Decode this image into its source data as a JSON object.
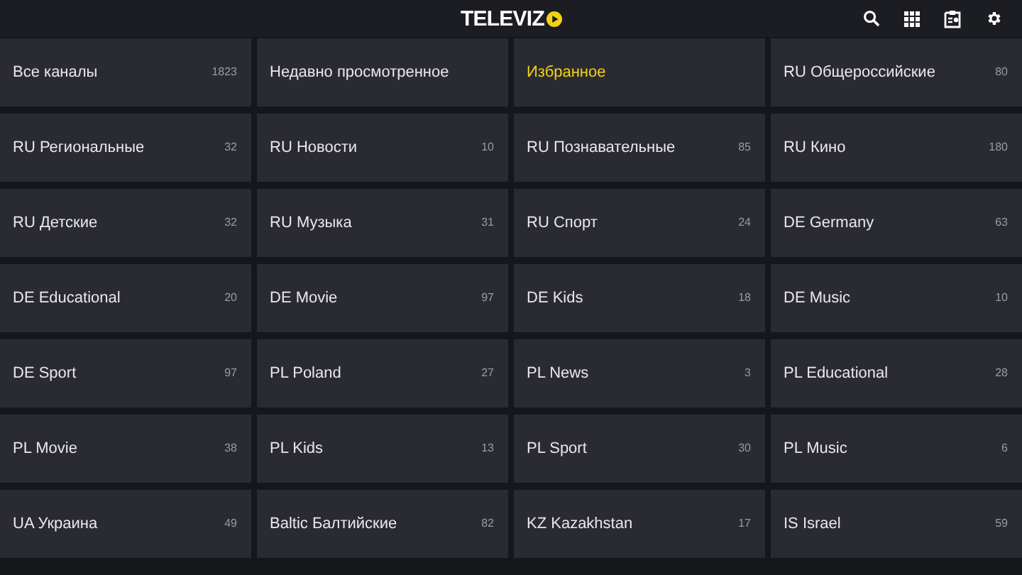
{
  "header": {
    "logo": "TELEVIZ"
  },
  "categories": [
    {
      "label": "Все каналы",
      "count": "1823",
      "selected": false
    },
    {
      "label": "Недавно просмотренное",
      "selected": false
    },
    {
      "label": "Избранное",
      "selected": true
    },
    {
      "label": "RU Общероссийские",
      "count": "80",
      "selected": false
    },
    {
      "label": "RU Региональные",
      "count": "32",
      "selected": false
    },
    {
      "label": "RU Новости",
      "count": "10",
      "selected": false
    },
    {
      "label": "RU Познавательные",
      "count": "85",
      "selected": false
    },
    {
      "label": "RU Кино",
      "count": "180",
      "selected": false
    },
    {
      "label": "RU Детские",
      "count": "32",
      "selected": false
    },
    {
      "label": "RU Музыка",
      "count": "31",
      "selected": false
    },
    {
      "label": "RU Спорт",
      "count": "24",
      "selected": false
    },
    {
      "label": "DE Germany",
      "count": "63",
      "selected": false
    },
    {
      "label": "DE Educational",
      "count": "20",
      "selected": false
    },
    {
      "label": "DE Movie",
      "count": "97",
      "selected": false
    },
    {
      "label": "DE Kids",
      "count": "18",
      "selected": false
    },
    {
      "label": "DE Music",
      "count": "10",
      "selected": false
    },
    {
      "label": "DE Sport",
      "count": "97",
      "selected": false
    },
    {
      "label": "PL Poland",
      "count": "27",
      "selected": false
    },
    {
      "label": "PL News",
      "count": "3",
      "selected": false
    },
    {
      "label": "PL Educational",
      "count": "28",
      "selected": false
    },
    {
      "label": "PL Movie",
      "count": "38",
      "selected": false
    },
    {
      "label": "PL Kids",
      "count": "13",
      "selected": false
    },
    {
      "label": "PL Sport",
      "count": "30",
      "selected": false
    },
    {
      "label": "PL Music",
      "count": "6",
      "selected": false
    },
    {
      "label": "UA Украина",
      "count": "49",
      "selected": false
    },
    {
      "label": "Baltic Балтийские",
      "count": "82",
      "selected": false
    },
    {
      "label": "KZ Kazakhstan",
      "count": "17",
      "selected": false
    },
    {
      "label": "IS Israel",
      "count": "59",
      "selected": false
    }
  ]
}
